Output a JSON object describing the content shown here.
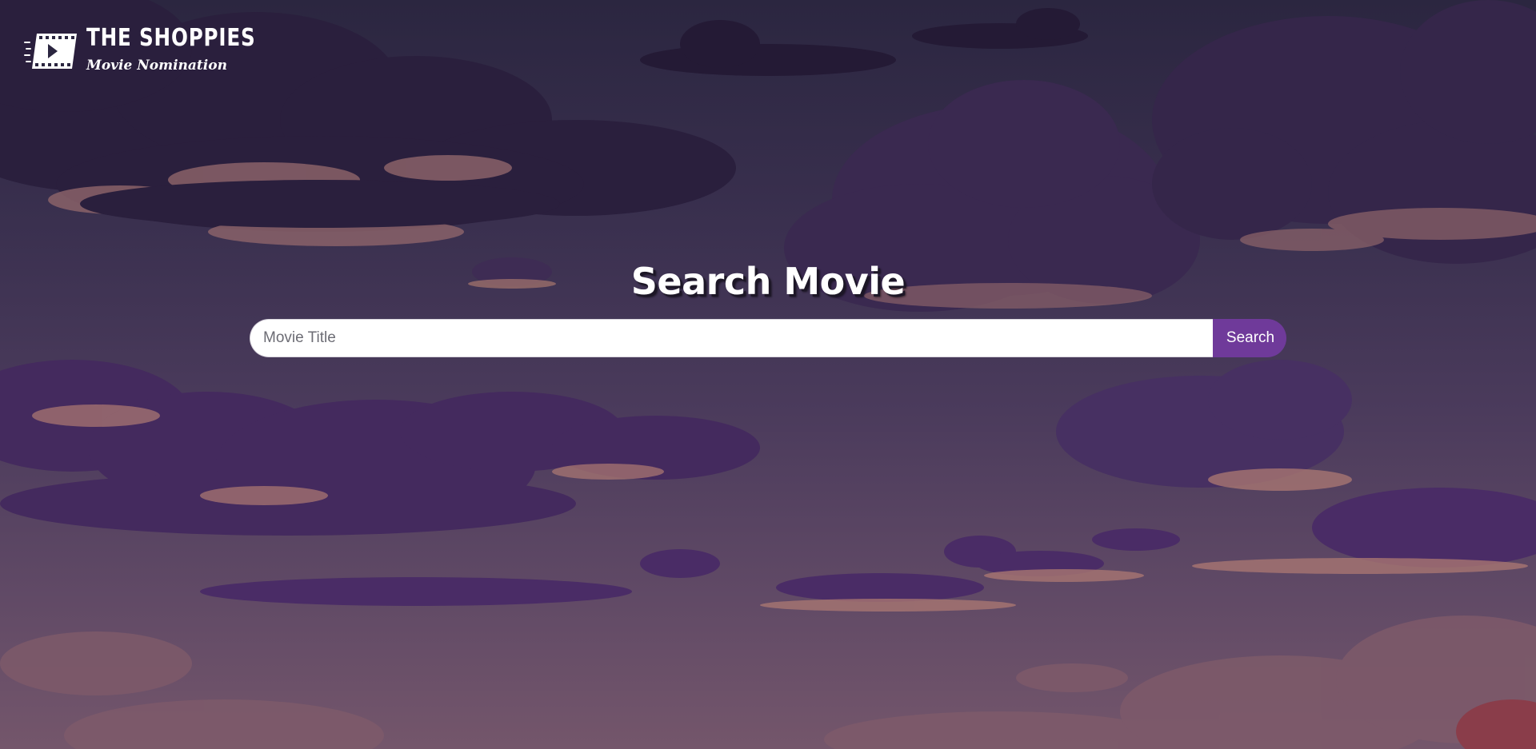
{
  "brand": {
    "title": "THE SHOPPIES",
    "subtitle": "Movie Nomination"
  },
  "main": {
    "heading": "Search Movie",
    "search": {
      "placeholder": "Movie Title",
      "value": "",
      "button_label": "Search"
    }
  },
  "colors": {
    "accent": "#6f3a9a",
    "background_top": "#2b2640",
    "background_bottom": "#74566b",
    "cloud_dark": "#3d2a55",
    "cloud_purple": "#4f2e66",
    "cloud_highlight": "#a8766f"
  },
  "icons": {
    "logo": "film-play-icon"
  }
}
